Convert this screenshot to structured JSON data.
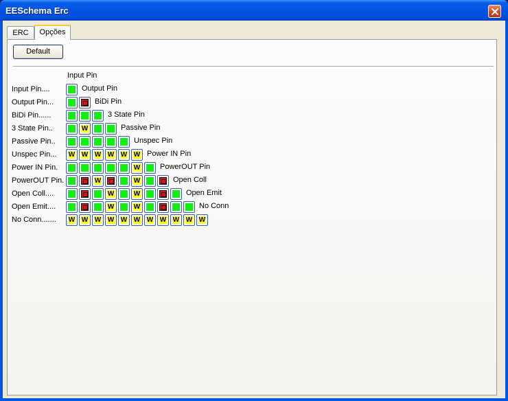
{
  "window": {
    "title": "EESchema Erc"
  },
  "tabs": [
    {
      "label": "ERC"
    },
    {
      "label": "Opções"
    }
  ],
  "buttons": {
    "default_label": "Default"
  },
  "matrix": {
    "rows": [
      {
        "label": "Input Pin....",
        "column_label": "Output Pin",
        "cells": [
          "ok"
        ]
      },
      {
        "label": "Output Pin...",
        "column_label": "BiDi Pin",
        "cells": [
          "ok",
          "err"
        ]
      },
      {
        "label": "BiDi Pin......",
        "column_label": "3 State Pin",
        "cells": [
          "ok",
          "ok",
          "ok"
        ]
      },
      {
        "label": "3 State Pin..",
        "column_label": "Passive Pin",
        "cells": [
          "ok",
          "warn",
          "ok",
          "ok"
        ]
      },
      {
        "label": "Passive Pin..",
        "column_label": "Unspec Pin",
        "cells": [
          "ok",
          "ok",
          "ok",
          "ok",
          "ok"
        ]
      },
      {
        "label": "Unspec Pin...",
        "column_label": "Power IN Pin",
        "cells": [
          "warn",
          "warn",
          "warn",
          "warn",
          "warn",
          "warn"
        ]
      },
      {
        "label": "Power IN Pin.",
        "column_label": "PowerOUT Pin",
        "cells": [
          "ok",
          "ok",
          "ok",
          "ok",
          "ok",
          "warn",
          "ok"
        ]
      },
      {
        "label": "PowerOUT Pin.",
        "column_label": "Open Coll",
        "cells": [
          "ok",
          "err",
          "warn",
          "err",
          "ok",
          "warn",
          "ok",
          "err"
        ]
      },
      {
        "label": "Open Coll....",
        "column_label": "Open Emit",
        "cells": [
          "ok",
          "err",
          "ok",
          "warn",
          "ok",
          "warn",
          "ok",
          "err",
          "ok"
        ]
      },
      {
        "label": "Open Emit....",
        "column_label": "No Conn",
        "cells": [
          "ok",
          "err",
          "ok",
          "warn",
          "ok",
          "warn",
          "ok",
          "err",
          "ok",
          "ok"
        ]
      },
      {
        "label": "No Conn.......",
        "column_label": "",
        "cells": [
          "warn",
          "warn",
          "warn",
          "warn",
          "warn",
          "warn",
          "warn",
          "warn",
          "warn",
          "warn",
          "warn"
        ]
      }
    ],
    "top_label": "Input Pin",
    "warn_glyph": "W",
    "err_glyph": "E"
  },
  "colors": {
    "ok": "#11ee11",
    "warn": "#ffff22",
    "err": "#cc1111",
    "title_bar": "#0053e1",
    "close": "#d14a22"
  },
  "icons": {
    "close": "close-icon"
  }
}
